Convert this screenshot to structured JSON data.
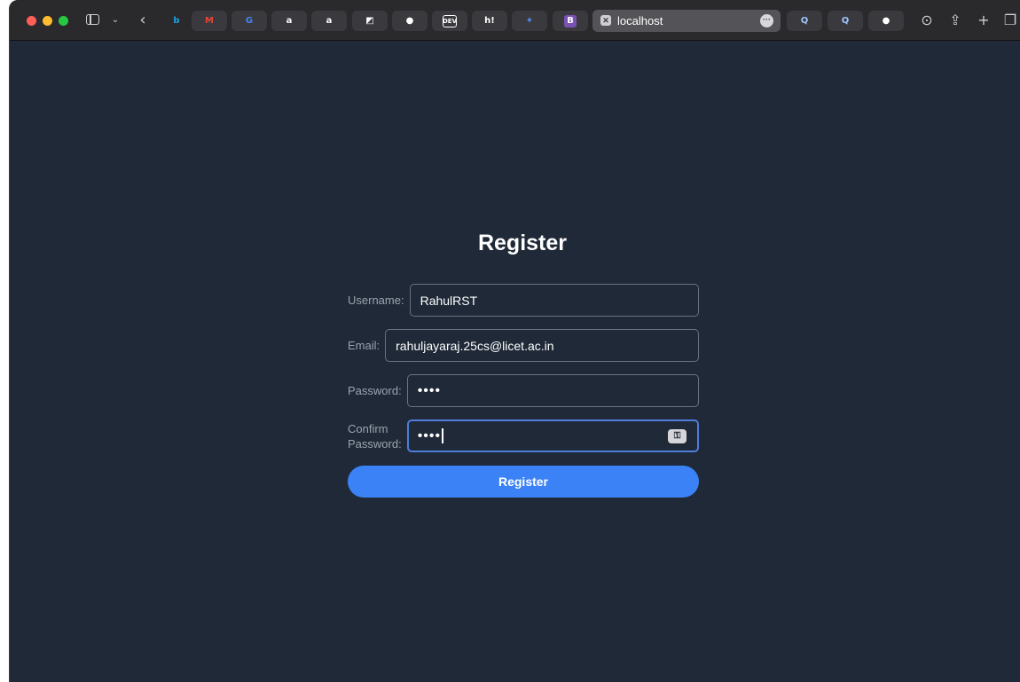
{
  "browser": {
    "favorites": [
      {
        "name": "bing-icon",
        "glyph": "b",
        "color": "#1ba1e2"
      },
      {
        "name": "gmail-icon",
        "glyph": "M",
        "color": "#ea4335"
      },
      {
        "name": "google-icon",
        "glyph": "G",
        "color": "#4285f4"
      },
      {
        "name": "amazon-icon",
        "glyph": "a",
        "color": "#ffffff"
      },
      {
        "name": "amazon-icon",
        "glyph": "a",
        "color": "#ffffff"
      },
      {
        "name": "notion-icon",
        "glyph": "◩",
        "color": "#ffffff"
      },
      {
        "name": "github-icon",
        "glyph": "●",
        "color": "#ffffff"
      },
      {
        "name": "dev-icon",
        "glyph": "DEV",
        "color": "#ffffff"
      },
      {
        "name": "hashnode-icon",
        "glyph": "h!",
        "color": "#ffffff"
      },
      {
        "name": "gemini-icon",
        "glyph": "✦",
        "color": "#4f8bf5"
      },
      {
        "name": "bootstrap-icon",
        "glyph": "B",
        "color": "#7952b3"
      }
    ],
    "address_bar": {
      "url": "localhost"
    },
    "right_favorites": [
      {
        "name": "search-icon",
        "glyph": "Q",
        "color": "#9fc7ff"
      },
      {
        "name": "search-icon",
        "glyph": "Q",
        "color": "#9fc7ff"
      },
      {
        "name": "github-icon",
        "glyph": "●",
        "color": "#ffffff"
      }
    ]
  },
  "form": {
    "title": "Register",
    "username": {
      "label": "Username:",
      "value": "RahulRST"
    },
    "email": {
      "label": "Email:",
      "value": "rahuljayaraj.25cs@licet.ac.in"
    },
    "password": {
      "label": "Password:",
      "value": "••••"
    },
    "confirm_password": {
      "label_line1": "Confirm",
      "label_line2": "Password:",
      "value": "••••"
    },
    "submit_label": "Register"
  }
}
